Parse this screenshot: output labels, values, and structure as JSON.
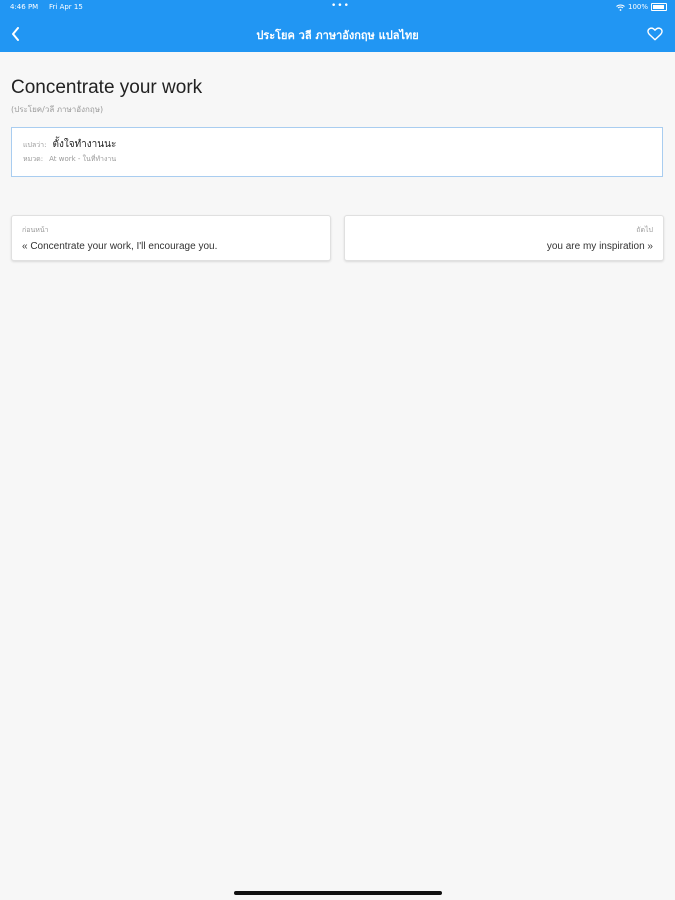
{
  "status_bar": {
    "time": "4:46 PM",
    "date": "Fri Apr 15",
    "dots": "•••",
    "battery": "100%"
  },
  "nav": {
    "title": "ประโยค วลี ภาษาอังกฤษ แปลไทย",
    "back_icon": "chevron-left-icon",
    "favorite_icon": "heart-outline-icon"
  },
  "phrase": {
    "title": "Concentrate your work",
    "subtitle": "(ประโยค/วลี ภาษาอังกฤษ)"
  },
  "translation": {
    "label": "แปลว่า:",
    "value": "ตั้งใจทำงานนะ",
    "category_label": "หมวด:",
    "category_value": "At work - ในที่ทำงาน"
  },
  "prev_card": {
    "label": "ก่อนหน้า",
    "text": "« Concentrate your work, I'll encourage you."
  },
  "next_card": {
    "label": "ถัดไป",
    "text": "you are my inspiration »"
  },
  "colors": {
    "header": "#2196f3",
    "background": "#f7f7f7",
    "box_border": "#a9cdf0"
  }
}
